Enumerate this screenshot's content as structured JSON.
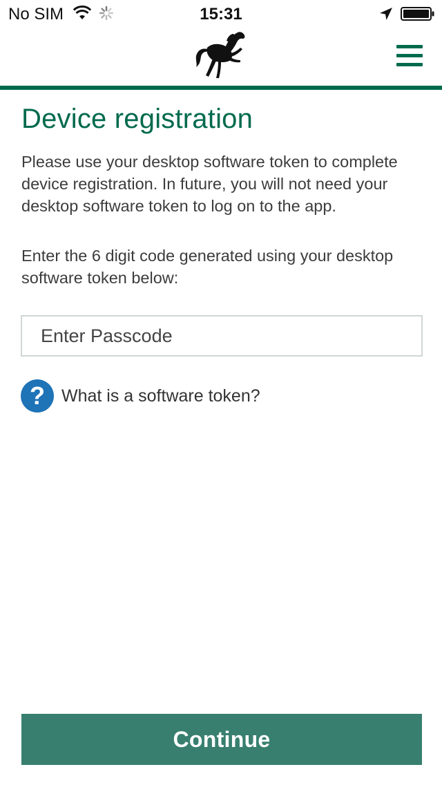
{
  "status_bar": {
    "carrier": "No SIM",
    "time": "15:31",
    "icons": [
      "wifi-icon",
      "activity-spinner-icon",
      "location-arrow-icon",
      "battery-icon"
    ]
  },
  "header": {
    "logo": "black-horse-logo",
    "menu_icon": "hamburger-menu-icon",
    "accent_color": "#006a4d"
  },
  "page": {
    "title": "Device registration",
    "intro": "Please use your desktop software token to complete device registration. In future, you will not need your desktop software token to log on to the app.",
    "instruction": "Enter the 6 digit code generated using your desktop software token below:"
  },
  "passcode_field": {
    "placeholder": "Enter Passcode",
    "value": ""
  },
  "help": {
    "icon": "question-mark-icon",
    "label": "What is a software token?",
    "icon_color": "#1f73b7"
  },
  "continue_button": {
    "label": "Continue",
    "color": "#387f6f"
  }
}
